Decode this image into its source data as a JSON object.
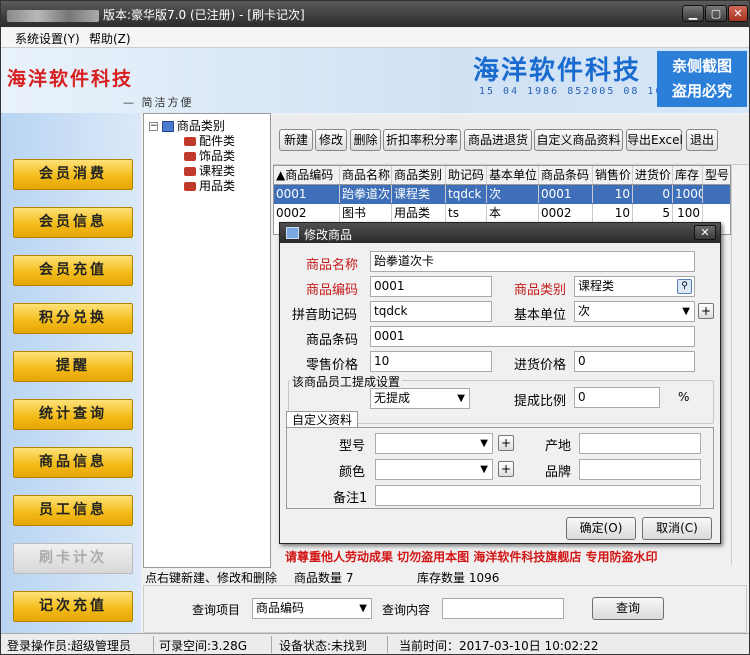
{
  "window": {
    "title_version": "版本:豪华版7.0 (已注册) - [刷卡记次]",
    "min_label": "▁",
    "max_label": "▢",
    "close_label": "✕"
  },
  "menu": {
    "settings": "系统设置(Y)",
    "help": "帮助(Z)"
  },
  "banner": {
    "left_logo": "海洋软件科技",
    "slogan": "— 简洁方便",
    "right_logo": "海洋软件科技",
    "number_strip": "15 04 1986 852005 08 10",
    "stamp_line1": "亲侧截图",
    "stamp_line2": "盗用必究"
  },
  "nav": [
    {
      "label": "会员消费",
      "dim": false
    },
    {
      "label": "会员信息",
      "dim": false
    },
    {
      "label": "会员充值",
      "dim": false
    },
    {
      "label": "积分兑换",
      "dim": false
    },
    {
      "label": "提醒",
      "dim": false
    },
    {
      "label": "统计查询",
      "dim": false
    },
    {
      "label": "商品信息",
      "dim": false
    },
    {
      "label": "员工信息",
      "dim": false
    },
    {
      "label": "刷卡计次",
      "dim": true
    },
    {
      "label": "记次充值",
      "dim": false
    }
  ],
  "tree": {
    "root_toggle": "−",
    "root": "商品类别",
    "children": [
      "配件类",
      "饰品类",
      "课程类",
      "用品类"
    ]
  },
  "toolbar": {
    "new": "新建",
    "modify": "修改",
    "delete": "删除",
    "discount": "折扣率积分率",
    "return": "商品进退货",
    "custom": "自定义商品资料",
    "export": "导出Excel",
    "exit": "退出"
  },
  "grid": {
    "headers": [
      "▲商品编码",
      "商品名称",
      "商品类别",
      "助记码",
      "基本单位",
      "商品条码",
      "销售价",
      "进货价",
      "库存",
      "型号"
    ],
    "rows": [
      [
        "0001",
        "跆拳道次",
        "课程类",
        "tqdck",
        "次",
        "0001",
        "10",
        "0",
        "1000",
        ""
      ],
      [
        "0002",
        "图书",
        "用品类",
        "ts",
        "本",
        "0002",
        "10",
        "5",
        "100",
        ""
      ]
    ]
  },
  "watermark": "请尊重他人劳动成果   切勿盗用本图   海洋软件科技旗舰店   专用防盗水印",
  "status_line": {
    "hint": "点右键新建、修改和删除",
    "count": "商品数量 7",
    "stock": "库存数量 1096"
  },
  "query": {
    "field_label": "查询项目",
    "field_value": "商品编码",
    "content_label": "查询内容",
    "content_value": "",
    "button": "查询"
  },
  "statusbar": {
    "operator": "登录操作员:超级管理员",
    "space": "可录空间:3.28G",
    "device": "设备状态:未找到",
    "time": "当前时间：2017-03-10日 10:02:22"
  },
  "dialog": {
    "title": "修改商品",
    "close": "✕",
    "name_label": "商品名称",
    "name_value": "跆拳道次卡",
    "code_label": "商品编码",
    "code_value": "0001",
    "category_label": "商品类别",
    "category_value": "课程类",
    "pinyin_label": "拼音助记码",
    "pinyin_value": "tqdck",
    "unit_label": "基本单位",
    "unit_value": "次",
    "barcode_label": "商品条码",
    "barcode_value": "0001",
    "retail_label": "零售价格",
    "retail_value": "10",
    "purchase_label": "进货价格",
    "purchase_value": "0",
    "commission_group": "该商品员工提成设置",
    "commission_type": "无提成",
    "ratio_label": "提成比例",
    "ratio_value": "0",
    "percent": "%",
    "custom_tab": "自定义资料",
    "model_label": "型号",
    "origin_label": "产地",
    "color_label": "颜色",
    "brand_label": "品牌",
    "note_label": "备注1",
    "plus": "+",
    "arrow": "▼",
    "ok": "确定(O)",
    "cancel": "取消(C)"
  }
}
